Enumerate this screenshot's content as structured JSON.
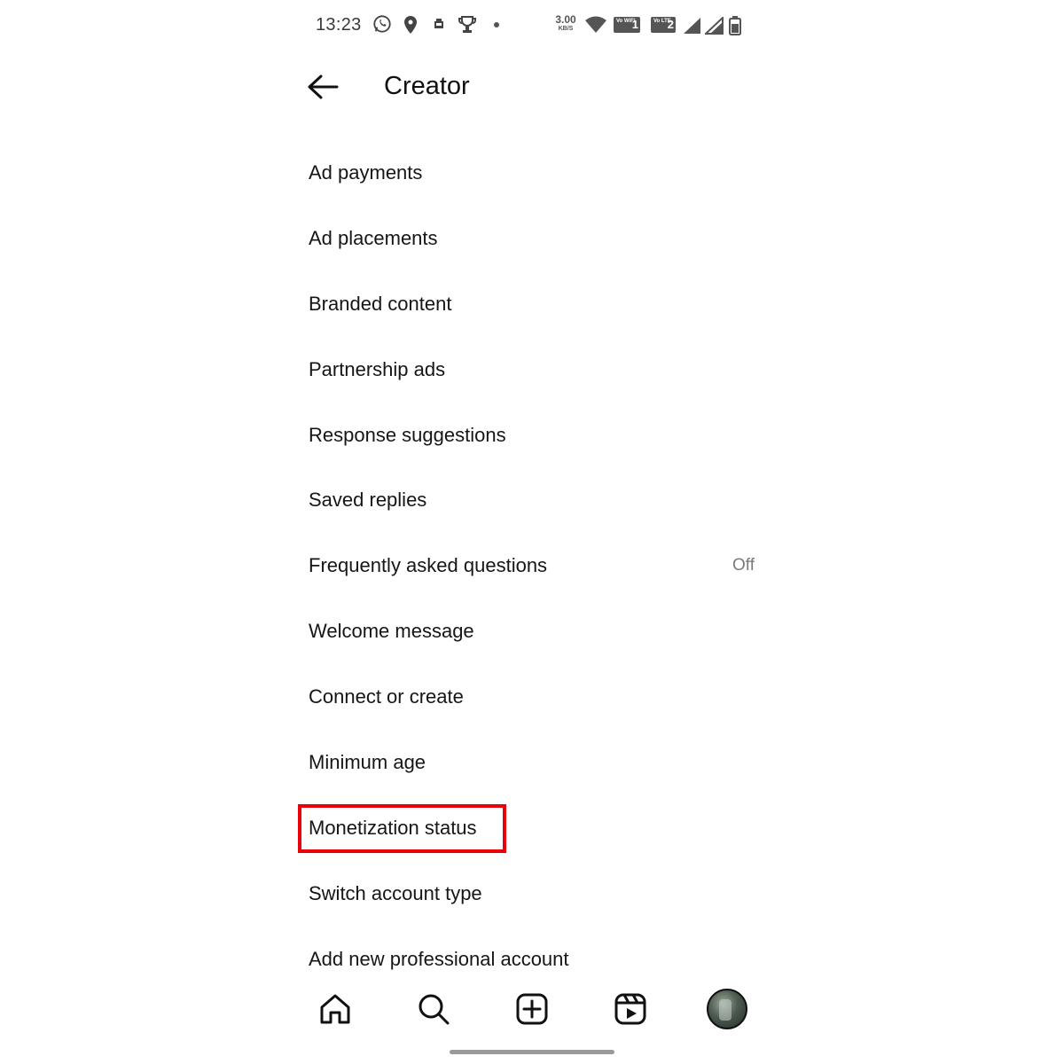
{
  "status_bar": {
    "time": "13:23",
    "speed_value": "3.00",
    "speed_unit": "KB/S",
    "wifi_badge": "Vo WiFi",
    "wifi_badge_num": "1",
    "lte_badge": "Vo LTE",
    "lte_badge_num": "2",
    "icons": [
      "whatsapp-icon",
      "location-pin-icon",
      "notification-icon",
      "trophy-icon",
      "wifi-icon",
      "signal-icon",
      "signal-icon",
      "battery-icon"
    ]
  },
  "header": {
    "title": "Creator",
    "back_icon": "arrow-left-icon"
  },
  "menu": {
    "items": [
      {
        "label": "Ad payments"
      },
      {
        "label": "Ad placements"
      },
      {
        "label": "Branded content"
      },
      {
        "label": "Partnership ads"
      },
      {
        "label": "Response suggestions"
      },
      {
        "label": "Saved replies"
      },
      {
        "label": "Frequently asked questions",
        "value": "Off"
      },
      {
        "label": "Welcome message"
      },
      {
        "label": "Connect or create"
      },
      {
        "label": "Minimum age"
      },
      {
        "label": "Monetization status",
        "highlighted": true
      },
      {
        "label": "Switch account type"
      },
      {
        "label": "Add new professional account"
      }
    ],
    "highlight_color": "#e8000b"
  },
  "bottom_nav": {
    "icons": [
      "home-icon",
      "search-icon",
      "create-icon",
      "reels-icon",
      "profile-avatar"
    ]
  }
}
